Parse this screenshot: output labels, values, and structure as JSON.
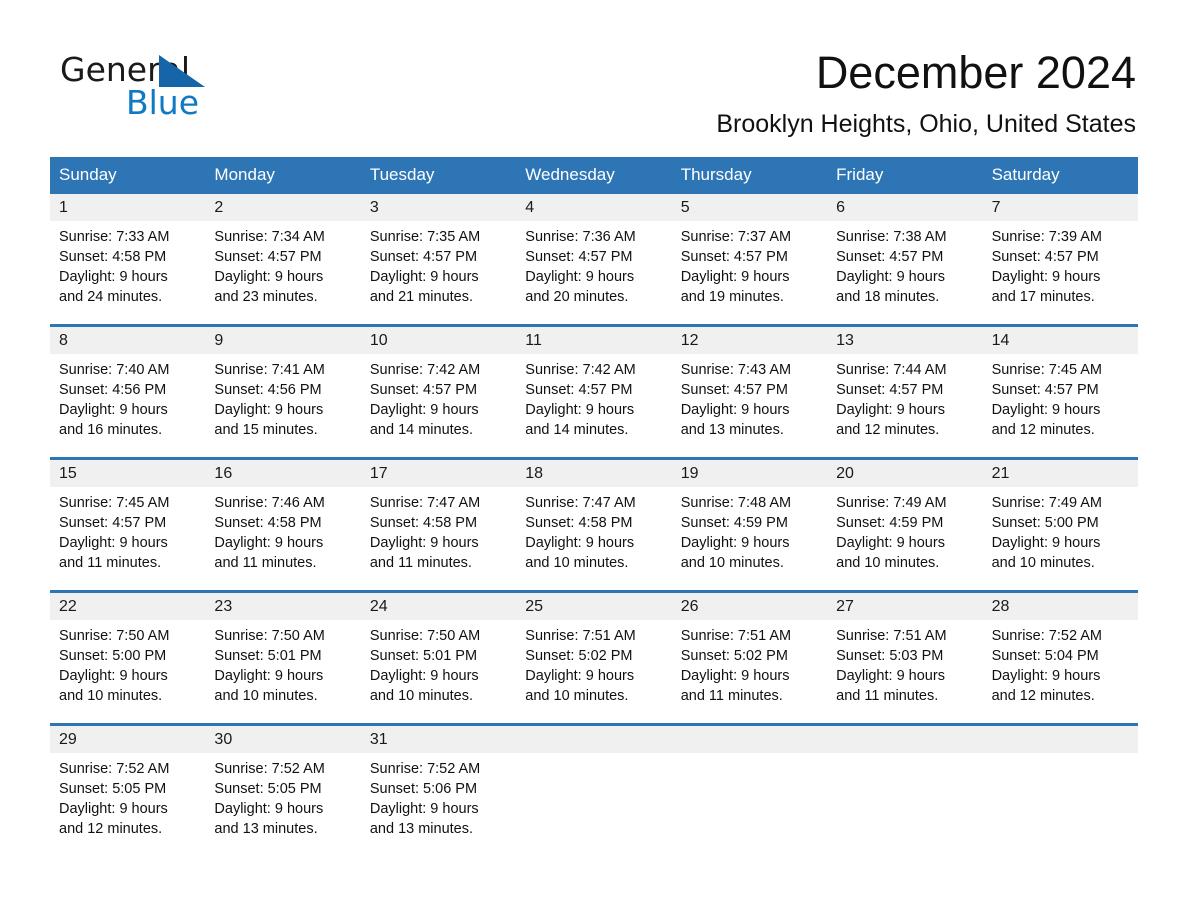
{
  "brand": {
    "name_top": "General",
    "name_bottom": "Blue",
    "triangle_icon": "blue-triangle-icon",
    "accent_color": "#1079c4"
  },
  "header": {
    "month_title": "December 2024",
    "location": "Brooklyn Heights, Ohio, United States"
  },
  "theme": {
    "header_blue": "#2e75b6",
    "row_border_blue": "#2e75b6",
    "date_strip_gray": "#f0f0f0",
    "text_color": "#111111"
  },
  "weekdays": [
    "Sunday",
    "Monday",
    "Tuesday",
    "Wednesday",
    "Thursday",
    "Friday",
    "Saturday"
  ],
  "weeks": [
    [
      {
        "day": "1",
        "sunrise": "Sunrise: 7:33 AM",
        "sunset": "Sunset: 4:58 PM",
        "daylight_line1": "Daylight: 9 hours",
        "daylight_line2": "and 24 minutes."
      },
      {
        "day": "2",
        "sunrise": "Sunrise: 7:34 AM",
        "sunset": "Sunset: 4:57 PM",
        "daylight_line1": "Daylight: 9 hours",
        "daylight_line2": "and 23 minutes."
      },
      {
        "day": "3",
        "sunrise": "Sunrise: 7:35 AM",
        "sunset": "Sunset: 4:57 PM",
        "daylight_line1": "Daylight: 9 hours",
        "daylight_line2": "and 21 minutes."
      },
      {
        "day": "4",
        "sunrise": "Sunrise: 7:36 AM",
        "sunset": "Sunset: 4:57 PM",
        "daylight_line1": "Daylight: 9 hours",
        "daylight_line2": "and 20 minutes."
      },
      {
        "day": "5",
        "sunrise": "Sunrise: 7:37 AM",
        "sunset": "Sunset: 4:57 PM",
        "daylight_line1": "Daylight: 9 hours",
        "daylight_line2": "and 19 minutes."
      },
      {
        "day": "6",
        "sunrise": "Sunrise: 7:38 AM",
        "sunset": "Sunset: 4:57 PM",
        "daylight_line1": "Daylight: 9 hours",
        "daylight_line2": "and 18 minutes."
      },
      {
        "day": "7",
        "sunrise": "Sunrise: 7:39 AM",
        "sunset": "Sunset: 4:57 PM",
        "daylight_line1": "Daylight: 9 hours",
        "daylight_line2": "and 17 minutes."
      }
    ],
    [
      {
        "day": "8",
        "sunrise": "Sunrise: 7:40 AM",
        "sunset": "Sunset: 4:56 PM",
        "daylight_line1": "Daylight: 9 hours",
        "daylight_line2": "and 16 minutes."
      },
      {
        "day": "9",
        "sunrise": "Sunrise: 7:41 AM",
        "sunset": "Sunset: 4:56 PM",
        "daylight_line1": "Daylight: 9 hours",
        "daylight_line2": "and 15 minutes."
      },
      {
        "day": "10",
        "sunrise": "Sunrise: 7:42 AM",
        "sunset": "Sunset: 4:57 PM",
        "daylight_line1": "Daylight: 9 hours",
        "daylight_line2": "and 14 minutes."
      },
      {
        "day": "11",
        "sunrise": "Sunrise: 7:42 AM",
        "sunset": "Sunset: 4:57 PM",
        "daylight_line1": "Daylight: 9 hours",
        "daylight_line2": "and 14 minutes."
      },
      {
        "day": "12",
        "sunrise": "Sunrise: 7:43 AM",
        "sunset": "Sunset: 4:57 PM",
        "daylight_line1": "Daylight: 9 hours",
        "daylight_line2": "and 13 minutes."
      },
      {
        "day": "13",
        "sunrise": "Sunrise: 7:44 AM",
        "sunset": "Sunset: 4:57 PM",
        "daylight_line1": "Daylight: 9 hours",
        "daylight_line2": "and 12 minutes."
      },
      {
        "day": "14",
        "sunrise": "Sunrise: 7:45 AM",
        "sunset": "Sunset: 4:57 PM",
        "daylight_line1": "Daylight: 9 hours",
        "daylight_line2": "and 12 minutes."
      }
    ],
    [
      {
        "day": "15",
        "sunrise": "Sunrise: 7:45 AM",
        "sunset": "Sunset: 4:57 PM",
        "daylight_line1": "Daylight: 9 hours",
        "daylight_line2": "and 11 minutes."
      },
      {
        "day": "16",
        "sunrise": "Sunrise: 7:46 AM",
        "sunset": "Sunset: 4:58 PM",
        "daylight_line1": "Daylight: 9 hours",
        "daylight_line2": "and 11 minutes."
      },
      {
        "day": "17",
        "sunrise": "Sunrise: 7:47 AM",
        "sunset": "Sunset: 4:58 PM",
        "daylight_line1": "Daylight: 9 hours",
        "daylight_line2": "and 11 minutes."
      },
      {
        "day": "18",
        "sunrise": "Sunrise: 7:47 AM",
        "sunset": "Sunset: 4:58 PM",
        "daylight_line1": "Daylight: 9 hours",
        "daylight_line2": "and 10 minutes."
      },
      {
        "day": "19",
        "sunrise": "Sunrise: 7:48 AM",
        "sunset": "Sunset: 4:59 PM",
        "daylight_line1": "Daylight: 9 hours",
        "daylight_line2": "and 10 minutes."
      },
      {
        "day": "20",
        "sunrise": "Sunrise: 7:49 AM",
        "sunset": "Sunset: 4:59 PM",
        "daylight_line1": "Daylight: 9 hours",
        "daylight_line2": "and 10 minutes."
      },
      {
        "day": "21",
        "sunrise": "Sunrise: 7:49 AM",
        "sunset": "Sunset: 5:00 PM",
        "daylight_line1": "Daylight: 9 hours",
        "daylight_line2": "and 10 minutes."
      }
    ],
    [
      {
        "day": "22",
        "sunrise": "Sunrise: 7:50 AM",
        "sunset": "Sunset: 5:00 PM",
        "daylight_line1": "Daylight: 9 hours",
        "daylight_line2": "and 10 minutes."
      },
      {
        "day": "23",
        "sunrise": "Sunrise: 7:50 AM",
        "sunset": "Sunset: 5:01 PM",
        "daylight_line1": "Daylight: 9 hours",
        "daylight_line2": "and 10 minutes."
      },
      {
        "day": "24",
        "sunrise": "Sunrise: 7:50 AM",
        "sunset": "Sunset: 5:01 PM",
        "daylight_line1": "Daylight: 9 hours",
        "daylight_line2": "and 10 minutes."
      },
      {
        "day": "25",
        "sunrise": "Sunrise: 7:51 AM",
        "sunset": "Sunset: 5:02 PM",
        "daylight_line1": "Daylight: 9 hours",
        "daylight_line2": "and 10 minutes."
      },
      {
        "day": "26",
        "sunrise": "Sunrise: 7:51 AM",
        "sunset": "Sunset: 5:02 PM",
        "daylight_line1": "Daylight: 9 hours",
        "daylight_line2": "and 11 minutes."
      },
      {
        "day": "27",
        "sunrise": "Sunrise: 7:51 AM",
        "sunset": "Sunset: 5:03 PM",
        "daylight_line1": "Daylight: 9 hours",
        "daylight_line2": "and 11 minutes."
      },
      {
        "day": "28",
        "sunrise": "Sunrise: 7:52 AM",
        "sunset": "Sunset: 5:04 PM",
        "daylight_line1": "Daylight: 9 hours",
        "daylight_line2": "and 12 minutes."
      }
    ],
    [
      {
        "day": "29",
        "sunrise": "Sunrise: 7:52 AM",
        "sunset": "Sunset: 5:05 PM",
        "daylight_line1": "Daylight: 9 hours",
        "daylight_line2": "and 12 minutes."
      },
      {
        "day": "30",
        "sunrise": "Sunrise: 7:52 AM",
        "sunset": "Sunset: 5:05 PM",
        "daylight_line1": "Daylight: 9 hours",
        "daylight_line2": "and 13 minutes."
      },
      {
        "day": "31",
        "sunrise": "Sunrise: 7:52 AM",
        "sunset": "Sunset: 5:06 PM",
        "daylight_line1": "Daylight: 9 hours",
        "daylight_line2": "and 13 minutes."
      },
      {
        "day": "",
        "sunrise": "",
        "sunset": "",
        "daylight_line1": "",
        "daylight_line2": ""
      },
      {
        "day": "",
        "sunrise": "",
        "sunset": "",
        "daylight_line1": "",
        "daylight_line2": ""
      },
      {
        "day": "",
        "sunrise": "",
        "sunset": "",
        "daylight_line1": "",
        "daylight_line2": ""
      },
      {
        "day": "",
        "sunrise": "",
        "sunset": "",
        "daylight_line1": "",
        "daylight_line2": ""
      }
    ]
  ]
}
